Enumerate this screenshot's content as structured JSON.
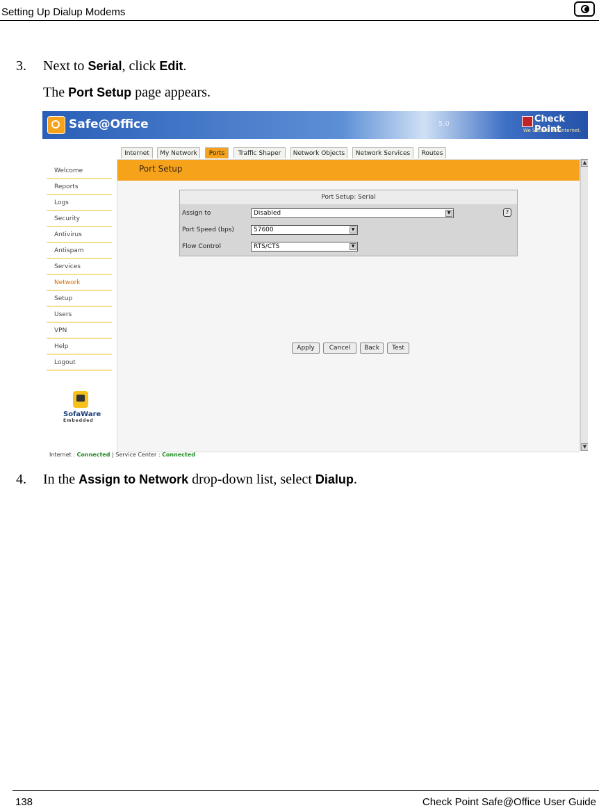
{
  "page_header": {
    "title": "Setting Up Dialup Modems"
  },
  "page_footer": {
    "page_number": "138",
    "doc_title": "Check Point Safe@Office User Guide"
  },
  "steps": [
    {
      "number": "3.",
      "pre": "Next to ",
      "ui1": "Serial",
      "mid": ", click ",
      "ui2": "Edit",
      "post": "."
    },
    {
      "number": "4.",
      "pre": "In the ",
      "ui1": "Assign to Network",
      "mid": " drop-down list, select ",
      "ui2": "Dialup",
      "post": "."
    }
  ],
  "step3_sub": {
    "pre": "The ",
    "ui": "Port Setup",
    "post": " page appears."
  },
  "screenshot": {
    "brand": "Safe@Office",
    "version": "5.0",
    "vendor": "Check Point",
    "vendor_tagline": "We Secure the Internet.",
    "tabs": [
      "Internet",
      "My Network",
      "Ports",
      "Traffic Shaper",
      "Network Objects",
      "Network Services",
      "Routes"
    ],
    "active_tab": "Ports",
    "nav": [
      "Welcome",
      "Reports",
      "Logs",
      "Security",
      "Antivirus",
      "Antispam",
      "Services",
      "Network",
      "Setup",
      "Users",
      "VPN",
      "Help",
      "Logout"
    ],
    "active_nav": "Network",
    "page_title": "Port Setup",
    "panel_title": "Port Setup: Serial",
    "fields": [
      {
        "label": "Assign to",
        "value": "Disabled"
      },
      {
        "label": "Port Speed (bps)",
        "value": "57600"
      },
      {
        "label": "Flow Control",
        "value": "RTS/CTS"
      }
    ],
    "buttons": [
      "Apply",
      "Cancel",
      "Back",
      "Test"
    ],
    "sofaware": {
      "name": "SofaWare",
      "sub": "Embedded"
    },
    "status": {
      "internet_label": "Internet : ",
      "internet_value": "Connected",
      "sep": " | Service Center : ",
      "service_value": "Connected"
    }
  }
}
